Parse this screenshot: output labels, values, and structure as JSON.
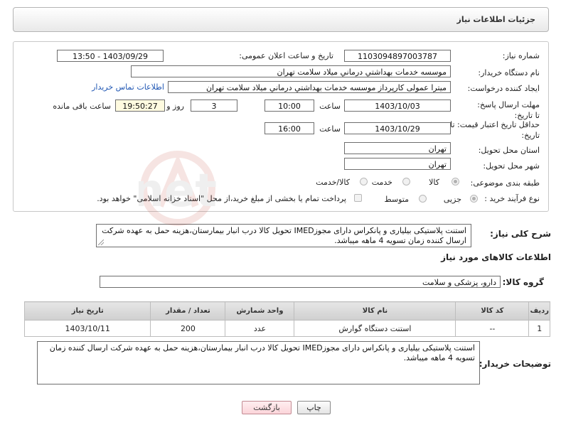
{
  "header": {
    "title": "جزئیات اطلاعات نیاز"
  },
  "form": {
    "need_number": {
      "label": "شماره نیاز:",
      "value": "1103094897003787"
    },
    "announce_datetime": {
      "label": "تاریخ و ساعت اعلان عمومی:",
      "value": "1403/09/29 - 13:50"
    },
    "buyer_org": {
      "label": "نام دستگاه خریدار:",
      "value": "موسسه خدمات بهداشتي درماني ميلاد سلامت تهران"
    },
    "requester": {
      "label": "ایجاد کننده درخواست:",
      "value": "میترا عمولی کارپرداز موسسه خدمات بهداشتي درماني ميلاد سلامت تهران",
      "link": "اطلاعات تماس خریدار"
    },
    "reply_deadline": {
      "label": "مهلت ارسال پاسخ: تا تاریخ:",
      "date": "1403/10/03",
      "time_label": "ساعت",
      "time": "10:00",
      "days": "3",
      "days_label": "روز و",
      "remaining": "19:50:27",
      "remaining_label": "ساعت باقی مانده"
    },
    "price_validity": {
      "label": "حداقل تاریخ اعتبار قیمت: تا تاریخ:",
      "date": "1403/10/29",
      "time_label": "ساعت",
      "time": "16:00"
    },
    "delivery_province": {
      "label": "استان محل تحویل:",
      "value": "تهران"
    },
    "delivery_city": {
      "label": "شهر محل تحویل:",
      "value": "تهران"
    },
    "category": {
      "label": "طبقه بندی موضوعی:",
      "options": [
        "کالا",
        "خدمت",
        "کالا/خدمت"
      ],
      "selected": "کالا"
    },
    "purchase_process": {
      "label": "نوع فرآیند خرید :",
      "options": [
        "جزیی",
        "متوسط"
      ],
      "selected": "جزیی",
      "payment_note": "پرداخت تمام یا بخشی از مبلغ خرید،از محل \"اسناد خزانه اسلامی\" خواهد بود."
    }
  },
  "summary": {
    "label": "شرح کلی نیاز:",
    "text": "استنت پلاستیکی بیلیاری و پانکراس دارای مجوزIMED تحویل کالا درب انبار بیمارستان،هزینه حمل به عهده شرکت ارسال کننده زمان تسویه 4 ماهه میباشد."
  },
  "goods": {
    "section_title": "اطلاعات کالاهای مورد نیاز",
    "group_label": "گروه کالا:",
    "group_value": "دارو، پزشکی و سلامت",
    "columns": [
      "ردیف",
      "کد کالا",
      "نام کالا",
      "واحد شمارش",
      "تعداد / مقدار",
      "تاریخ نیاز"
    ],
    "rows": [
      [
        "1",
        "--",
        "استنت دستگاه گوارش",
        "عدد",
        "200",
        "1403/10/11"
      ]
    ]
  },
  "buyer_notes": {
    "label": "توضیحات خریدار:",
    "text": "استنت پلاستیکی بیلیاری و پانکراس دارای مجوزIMED تحویل کالا درب انبار بیمارستان،هزینه حمل به عهده شرکت ارسال کننده زمان تسویه 4 ماهه میباشد."
  },
  "buttons": {
    "print": "چاپ",
    "back": "بازگشت"
  },
  "watermark": {
    "text": "AriaTender.net"
  }
}
